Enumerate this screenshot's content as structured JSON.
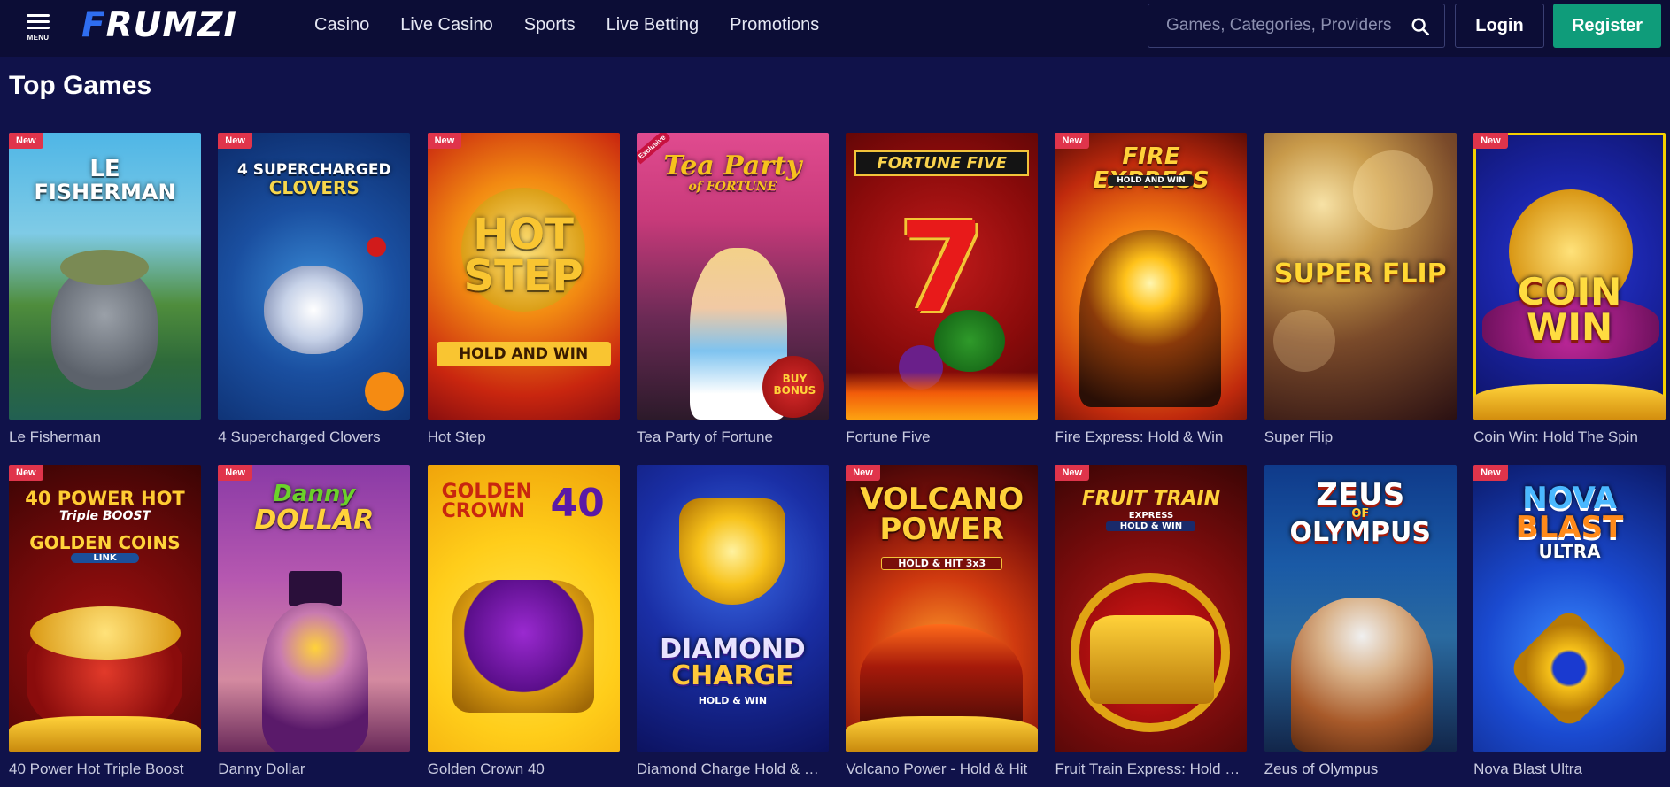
{
  "header": {
    "menu_label": "MENU",
    "logo": "FRUMZI",
    "nav": [
      "Casino",
      "Live Casino",
      "Sports",
      "Live Betting",
      "Promotions"
    ],
    "search_placeholder": "Games, Categories, Providers",
    "login_label": "Login",
    "register_label": "Register"
  },
  "section": {
    "title": "Top Games"
  },
  "games": [
    {
      "name": "Le Fisherman",
      "badge": "New"
    },
    {
      "name": "4 Supercharged Clovers",
      "badge": "New"
    },
    {
      "name": "Hot Step",
      "badge": "New"
    },
    {
      "name": "Tea Party of Fortune",
      "badge": "Exclusive"
    },
    {
      "name": "Fortune Five",
      "badge": ""
    },
    {
      "name": "Fire Express: Hold & Win",
      "badge": "New"
    },
    {
      "name": "Super Flip",
      "badge": ""
    },
    {
      "name": "Coin Win: Hold The Spin",
      "badge": "New"
    },
    {
      "name": "40 Power Hot Triple Boost",
      "badge": "New"
    },
    {
      "name": "Danny Dollar",
      "badge": "New"
    },
    {
      "name": "Golden Crown 40",
      "badge": ""
    },
    {
      "name": "Diamond Charge Hold & Win",
      "badge": ""
    },
    {
      "name": "Volcano Power - Hold & Hit",
      "badge": "New"
    },
    {
      "name": "Fruit Train Express: Hold & Win",
      "badge": "New"
    },
    {
      "name": "Zeus of Olympus",
      "badge": ""
    },
    {
      "name": "Nova Blast Ultra",
      "badge": "New"
    }
  ],
  "thumb_text": {
    "g1": [
      "LE",
      "FISHERMAN"
    ],
    "g2": [
      "4 SUPERCHARGED",
      "CLOVERS"
    ],
    "g3": [
      "HOT",
      "STEP",
      "HOLD AND WIN"
    ],
    "g4": [
      "Tea Party",
      "of FORTUNE",
      "BUY BONUS"
    ],
    "g5": [
      "FORTUNE FIVE",
      "7"
    ],
    "g6": [
      "FIRE EXPRESS",
      "HOLD AND WIN"
    ],
    "g7": [
      "SUPER FLIP"
    ],
    "g8": [
      "COIN",
      "WIN"
    ],
    "g9": [
      "40 POWER HOT",
      "Triple BOOST",
      "GOLDEN COINS",
      "LINK"
    ],
    "g10": [
      "Danny",
      "DOLLAR"
    ],
    "g11": [
      "GOLDEN",
      "CROWN",
      "40"
    ],
    "g12": [
      "DIAMOND",
      "CHARGE",
      "HOLD & WIN"
    ],
    "g13": [
      "VOLCANO",
      "POWER",
      "HOLD & HIT 3x3"
    ],
    "g14": [
      "FRUIT TRAIN",
      "EXPRESS",
      "HOLD & WIN"
    ],
    "g15": [
      "ZEUS",
      "OF",
      "OLYMPUS"
    ],
    "g16": [
      "NOVA",
      "BLAST",
      "ULTRA"
    ]
  },
  "colors": {
    "page_bg": "#10124a",
    "header_bg": "#0c0d36",
    "register_bg": "#0f9c7a",
    "badge_bg": "#e0344b",
    "selected_outline": "#f5d000"
  }
}
